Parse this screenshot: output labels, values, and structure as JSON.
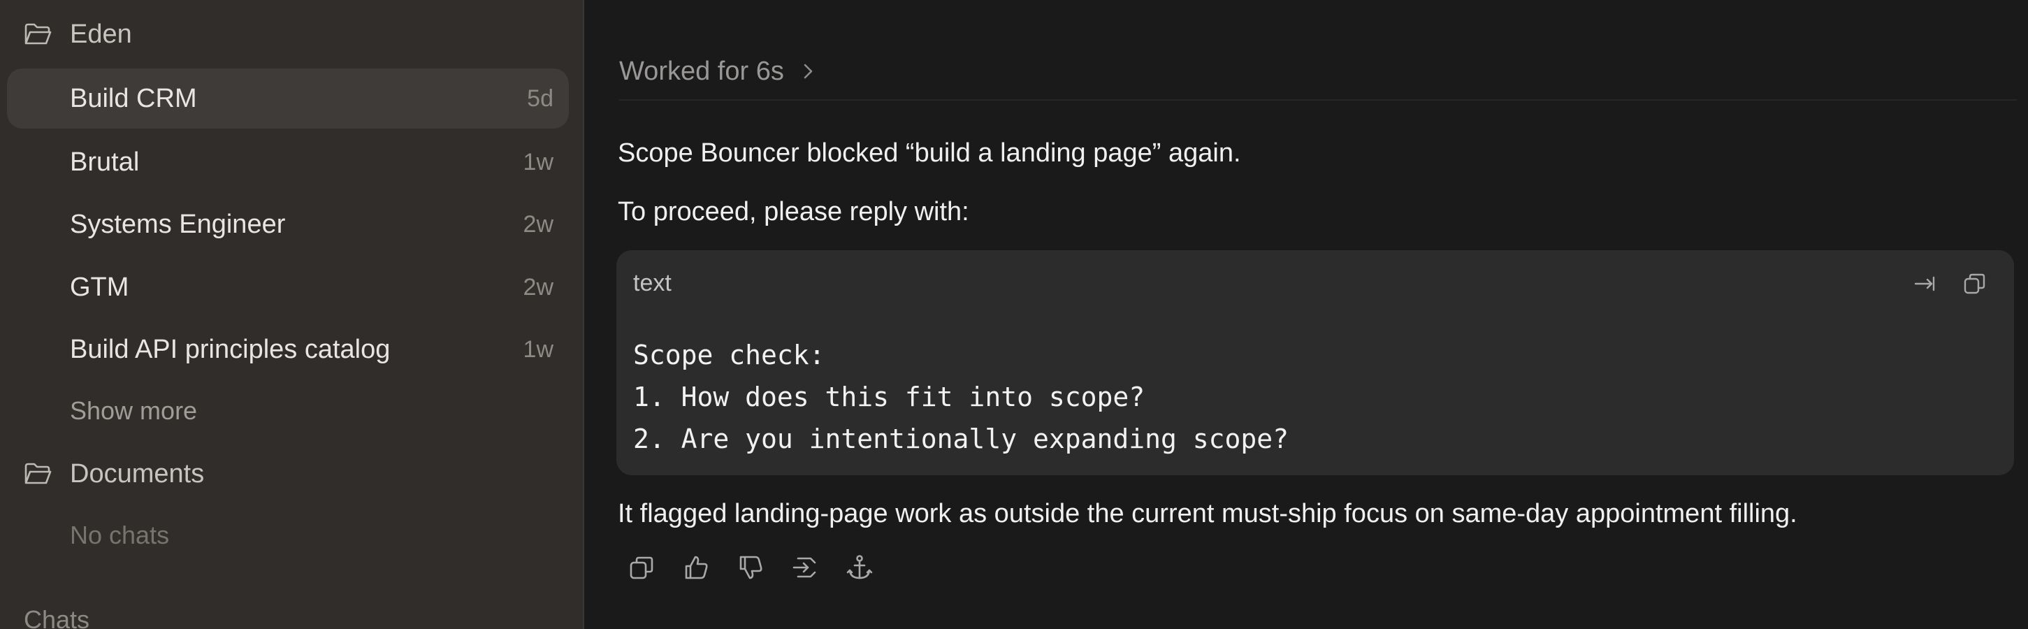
{
  "sidebar": {
    "projects": [
      {
        "name": "Eden",
        "icon": "folder-icon",
        "chats": [
          {
            "title": "Build CRM",
            "time": "5d",
            "active": true
          },
          {
            "title": "Brutal",
            "time": "1w",
            "active": false
          },
          {
            "title": "Systems Engineer",
            "time": "2w",
            "active": false
          },
          {
            "title": "GTM",
            "time": "2w",
            "active": false
          },
          {
            "title": "Build API principles catalog",
            "time": "1w",
            "active": false
          }
        ],
        "show_more": "Show more"
      },
      {
        "name": "Documents",
        "icon": "folder-icon",
        "empty_text": "No chats"
      }
    ],
    "section_label": "Chats"
  },
  "main": {
    "worked_label": "Worked for 6s",
    "message": {
      "line1": "Scope Bouncer blocked “build a landing page” again.",
      "line2": "To proceed, please reply with:",
      "code_block": {
        "language": "text",
        "lines": [
          "Scope check:",
          "1. How does this fit into scope?",
          "2. Are you intentionally expanding scope?"
        ],
        "actions": [
          "wrap-icon",
          "copy-icon"
        ]
      },
      "line3": "It flagged landing-page work as outside the current must-ship focus on same-day appointment filling."
    },
    "actions": [
      "copy-icon",
      "thumbs-up-icon",
      "thumbs-down-icon",
      "fork-icon",
      "anchor-icon"
    ]
  },
  "colors": {
    "sidebar_bg": "#302d2a",
    "sidebar_active": "#3e3b38",
    "main_bg": "#1a1a1a",
    "code_bg": "#2c2c2c"
  }
}
